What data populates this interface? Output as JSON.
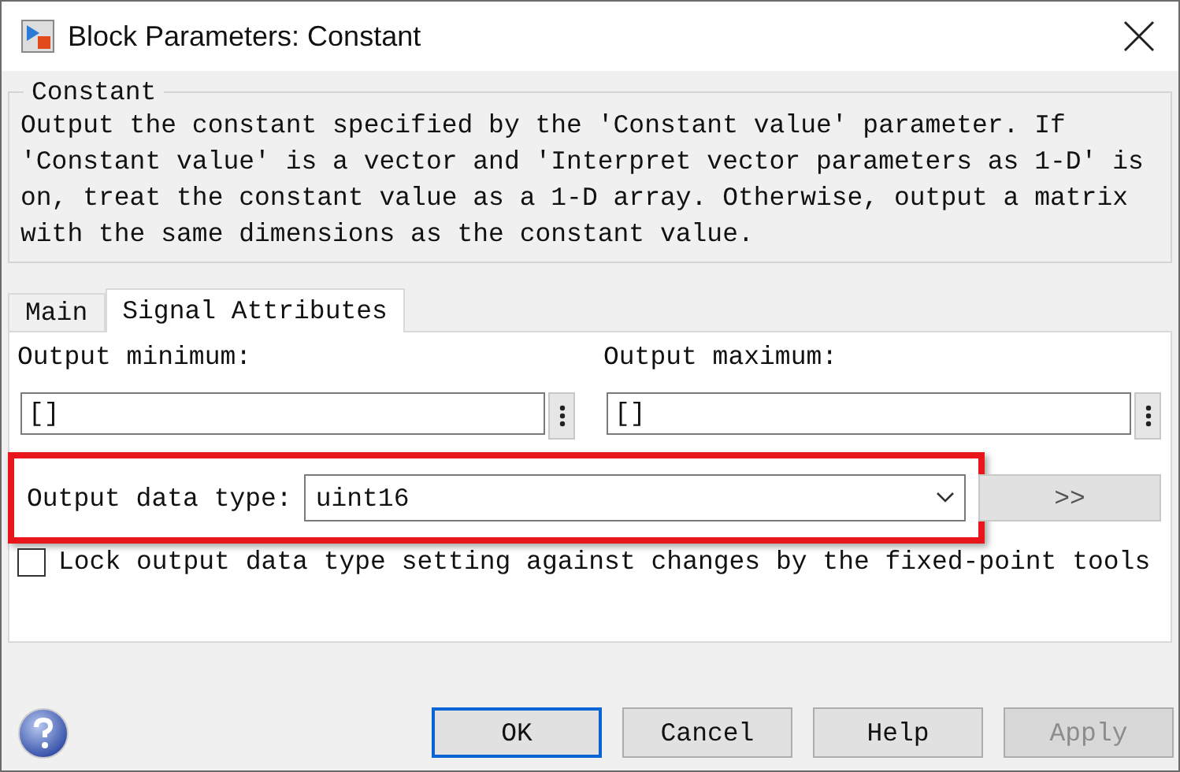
{
  "window": {
    "title": "Block Parameters: Constant"
  },
  "group": {
    "title": "Constant",
    "description": "Output the constant specified by the 'Constant value' parameter. If 'Constant value' is a vector and 'Interpret vector parameters as 1-D' is on, treat the constant value as a 1-D array. Otherwise, output a matrix with the same dimensions as the constant value."
  },
  "tabs": [
    {
      "label": "Main",
      "selected": false
    },
    {
      "label": "Signal Attributes",
      "selected": true
    }
  ],
  "fields": [
    {
      "label": "Output minimum:",
      "value": "[]"
    },
    {
      "label": "Output maximum:",
      "value": "[]"
    }
  ],
  "data_type": {
    "label": "Output data type:",
    "value": "uint16",
    "highlighted": true,
    "assistant_button": ">>"
  },
  "lock": {
    "label": "Lock output data type setting against changes by the fixed-point tools",
    "checked": false
  },
  "buttons": [
    {
      "label": "OK",
      "focused": true,
      "disabled": false
    },
    {
      "label": "Cancel",
      "focused": false,
      "disabled": false
    },
    {
      "label": "Help",
      "focused": false,
      "disabled": false
    },
    {
      "label": "Apply",
      "focused": false,
      "disabled": true
    }
  ]
}
